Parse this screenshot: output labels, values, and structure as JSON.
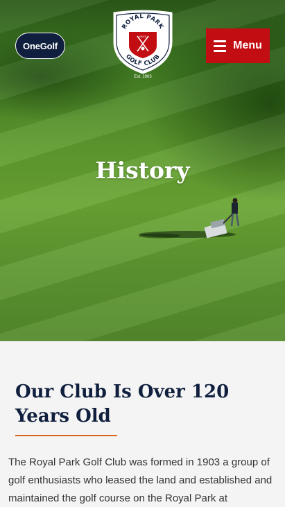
{
  "header": {
    "onegolf_label": "OneGolf",
    "menu_label": "Menu",
    "logo": {
      "top_text": "ROYAL PARK",
      "bottom_text": "GOLF CLUB",
      "since_text": "SINCE",
      "est_text": "Est. 1903"
    }
  },
  "hero": {
    "title": "History"
  },
  "article": {
    "heading": "Our Club Is Over 120 Years Old",
    "intro": "The Royal Park Golf Club was formed in 1903 a group of golf enthusiasts who leased the land and established and maintained the golf course on the Royal Park at"
  },
  "colors": {
    "navy": "#0f1f3d",
    "accent_red": "#c20d12",
    "accent_orange": "#d9661c"
  }
}
